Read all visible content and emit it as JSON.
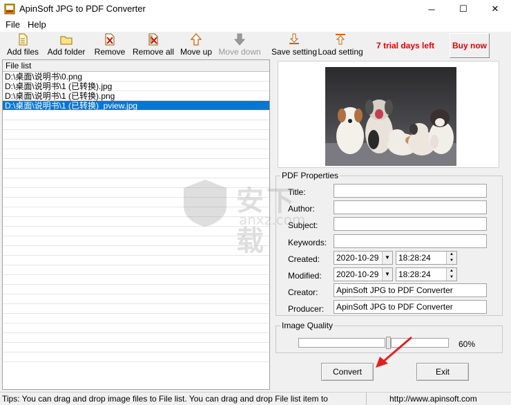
{
  "window": {
    "title": "ApinSoft JPG to PDF Converter",
    "min": "─",
    "max": "☐",
    "close": "✕"
  },
  "menu": {
    "file": "File",
    "help": "Help"
  },
  "toolbar": {
    "add_files": "Add files",
    "add_folder": "Add folder",
    "remove": "Remove",
    "remove_all": "Remove all",
    "move_up": "Move up",
    "move_down": "Move down",
    "save_setting": "Save setting",
    "load_setting": "Load setting",
    "trial": "7 trial days left",
    "buy_now": "Buy now"
  },
  "filelist": {
    "header": "File list",
    "rows": [
      "D:\\桌面\\说明书\\0.png",
      "D:\\桌面\\说明书\\1 (已转换).jpg",
      "D:\\桌面\\说明书\\1 (已转换).png",
      "D:\\桌面\\说明书\\1 (已转换)_pview.jpg"
    ],
    "selected_index": 3
  },
  "pdf_properties": {
    "group_title": "PDF Properties",
    "title_label": "Title:",
    "title_value": "",
    "author_label": "Author:",
    "author_value": "",
    "subject_label": "Subject:",
    "subject_value": "",
    "keywords_label": "Keywords:",
    "keywords_value": "",
    "created_label": "Created:",
    "created_date": "2020-10-29",
    "created_time": "18:28:24",
    "modified_label": "Modified:",
    "modified_date": "2020-10-29",
    "modified_time": "18:28:24",
    "creator_label": "Creator:",
    "creator_value": "ApinSoft JPG to PDF Converter",
    "producer_label": "Producer:",
    "producer_value": "ApinSoft JPG to PDF Converter"
  },
  "image_quality": {
    "group_title": "Image Quality",
    "value_label": "60%",
    "value": 0.6
  },
  "buttons": {
    "convert": "Convert",
    "exit": "Exit"
  },
  "statusbar": {
    "tips": "Tips: You can drag and drop image files to File list. You can drag and drop File list item to",
    "site": "http://www.apinsoft.com"
  },
  "watermark": {
    "text": "安下载",
    "sub": "anxz.com"
  },
  "colors": {
    "accent": "#0078d7",
    "trial": "#e00000"
  }
}
